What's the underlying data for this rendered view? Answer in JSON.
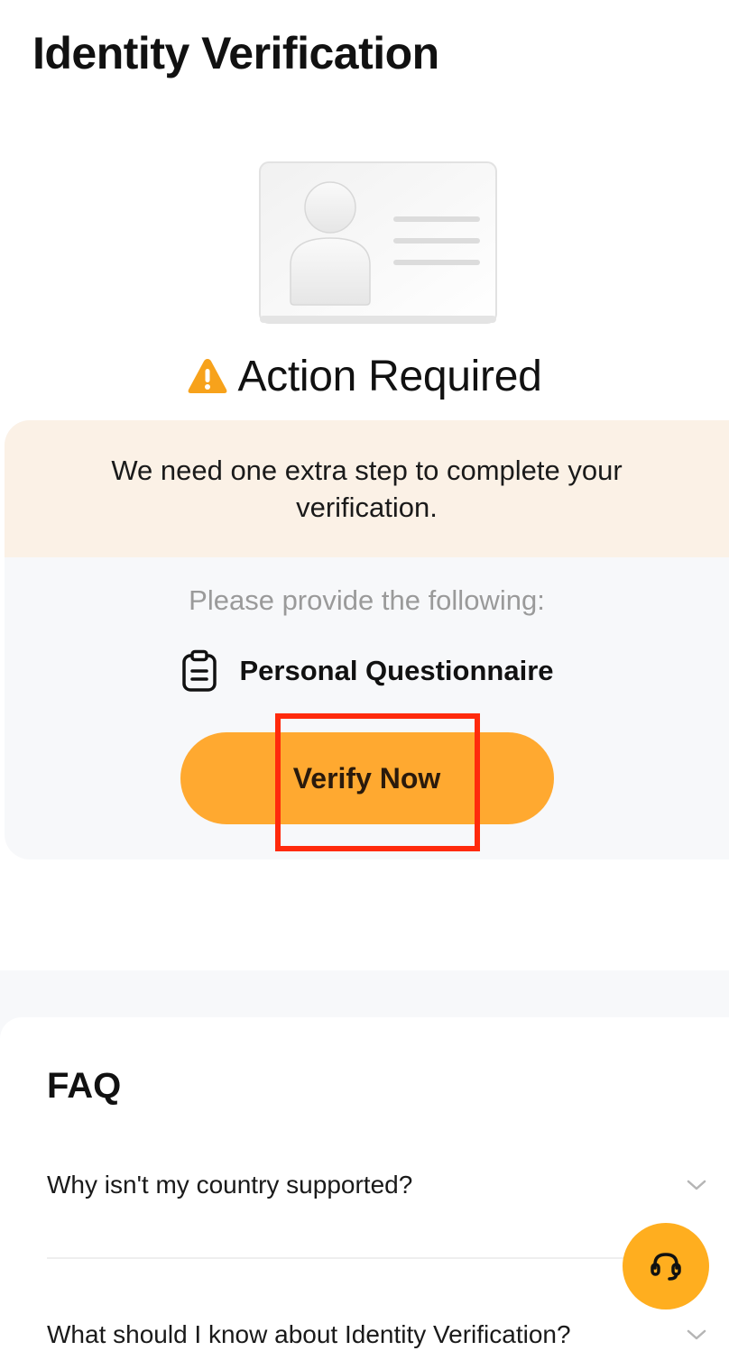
{
  "header": {
    "title": "Identity Verification"
  },
  "illustration": {
    "icon": "id-card-icon"
  },
  "status": {
    "icon": "warning-icon",
    "title": "Action Required"
  },
  "notice": {
    "message": "We need one extra step to complete your verification.",
    "requirements_heading": "Please provide the following:",
    "requirements": [
      {
        "icon": "clipboard-icon",
        "label": "Personal Questionnaire"
      }
    ],
    "verify_button_label": "Verify Now"
  },
  "faq": {
    "title": "FAQ",
    "items": [
      {
        "question": "Why isn't my country supported?"
      },
      {
        "question": "What should I know about Identity Verification?"
      }
    ]
  },
  "support": {
    "icon": "headset-icon"
  },
  "colors": {
    "accent": "#ffa930",
    "banner": "#fbf1e6",
    "card_background": "#f7f8fa",
    "highlight": "#ff2a0c",
    "warning": "#f7a21b"
  }
}
